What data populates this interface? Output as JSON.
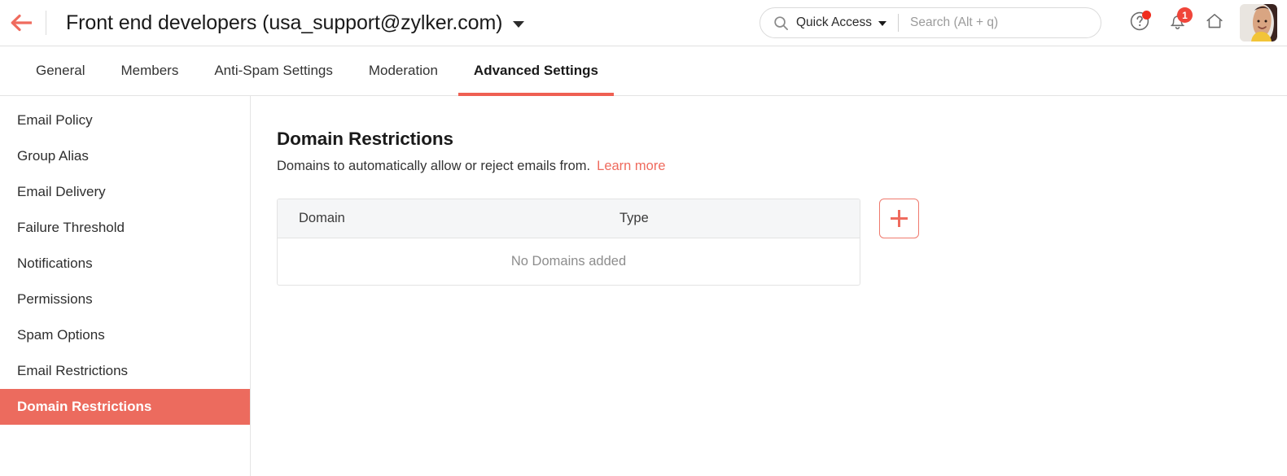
{
  "header": {
    "back_icon": "back-arrow-icon",
    "group_title": "Front end developers (usa_support@zylker.com)",
    "title_caret_icon": "chevron-down-icon",
    "search": {
      "search_icon": "search-icon",
      "quick_access_label": "Quick Access",
      "quick_access_caret_icon": "chevron-down-icon",
      "placeholder": "Search (Alt + q)",
      "value": ""
    },
    "help_icon": "help-circle-icon",
    "help_has_dot": true,
    "notifications_icon": "bell-icon",
    "notifications_count": "1",
    "home_icon": "home-icon",
    "avatar_icon": "user-avatar",
    "accent_color": "#ef6b5e",
    "badge_color": "#f0453a"
  },
  "tabs": [
    {
      "label": "General",
      "active": false
    },
    {
      "label": "Members",
      "active": false
    },
    {
      "label": "Anti-Spam Settings",
      "active": false
    },
    {
      "label": "Moderation",
      "active": false
    },
    {
      "label": "Advanced Settings",
      "active": true
    }
  ],
  "sidebar": {
    "items": [
      {
        "label": "Email Policy",
        "active": false
      },
      {
        "label": "Group Alias",
        "active": false
      },
      {
        "label": "Email Delivery",
        "active": false
      },
      {
        "label": "Failure Threshold",
        "active": false
      },
      {
        "label": "Notifications",
        "active": false
      },
      {
        "label": "Permissions",
        "active": false
      },
      {
        "label": "Spam Options",
        "active": false
      },
      {
        "label": "Email Restrictions",
        "active": false
      },
      {
        "label": "Domain Restrictions",
        "active": true
      }
    ],
    "active_color": "#ec6b5e"
  },
  "main": {
    "title": "Domain Restrictions",
    "description": "Domains to automatically allow or reject emails from.",
    "learn_more_label": "Learn more",
    "table": {
      "columns": [
        "Domain",
        "Type"
      ],
      "rows": [],
      "empty_message": "No Domains added"
    },
    "add_button_icon": "plus-icon",
    "add_button_color": "#ef6b5e"
  }
}
